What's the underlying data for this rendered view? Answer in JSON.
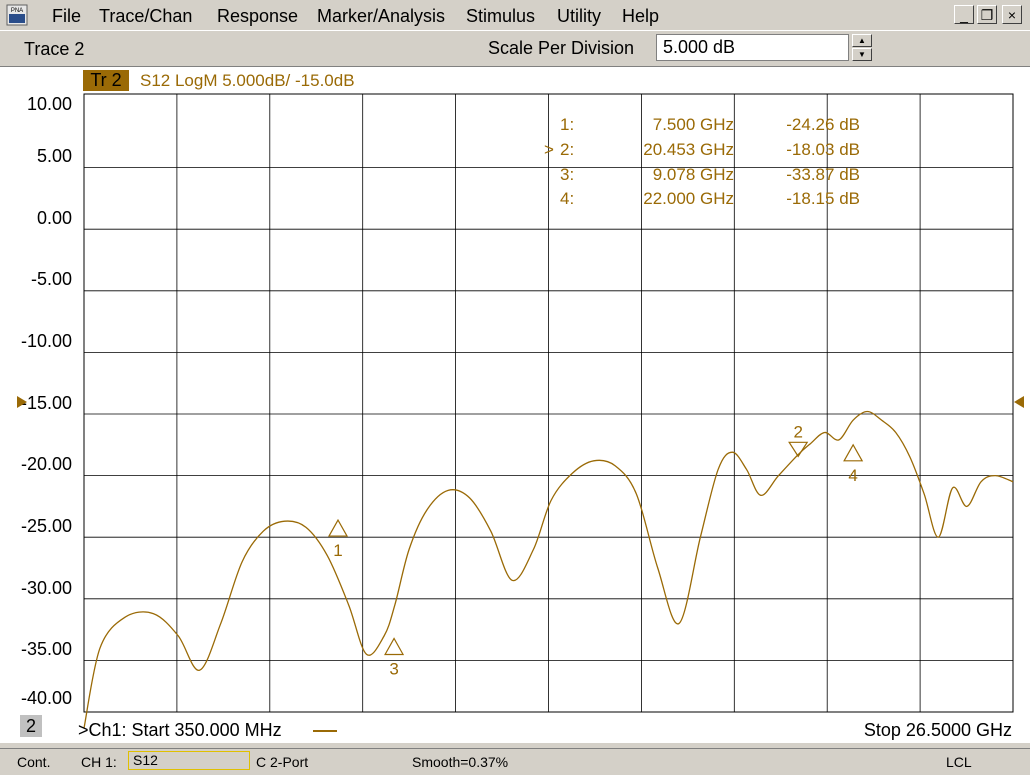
{
  "menu": {
    "items": [
      "File",
      "Trace/Chan",
      "Response",
      "Marker/Analysis",
      "Stimulus",
      "Utility",
      "Help"
    ],
    "app_icon_text": "PNA"
  },
  "window_controls": {
    "minimize": "_",
    "restore": "❐",
    "close": "×"
  },
  "toolbar": {
    "trace_label": "Trace 2",
    "scale_label": "Scale Per Division",
    "scale_value": "5.000 dB",
    "spin_up": "▲",
    "spin_down": "▼"
  },
  "trace": {
    "tag": "Tr 2",
    "info": "S12 LogM 5.000dB/  -15.0dB",
    "color": "#9a6a06"
  },
  "y_axis": {
    "labels": [
      "10.00",
      "5.00",
      "0.00",
      "-5.00",
      "-10.00",
      "-15.00",
      "-20.00",
      "-25.00",
      "-30.00",
      "-35.00",
      "-40.00"
    ]
  },
  "markers": {
    "rows": [
      {
        "id": "1:",
        "active": "",
        "freq": "7.500 GHz",
        "value": "-24.26 dB"
      },
      {
        "id": "2:",
        "active": ">",
        "freq": "20.453 GHz",
        "value": "-18.03 dB"
      },
      {
        "id": "3:",
        "active": "",
        "freq": "9.078 GHz",
        "value": "-33.87 dB"
      },
      {
        "id": "4:",
        "active": "",
        "freq": "22.000 GHz",
        "value": "-18.15 dB"
      }
    ],
    "labels": [
      "1",
      "2",
      "3",
      "4"
    ]
  },
  "channel": {
    "number": "2",
    "start": ">Ch1: Start  350.000 MHz",
    "stop": "Stop  26.5000 GHz"
  },
  "status": {
    "mode": "Cont.",
    "channel": "CH 1:",
    "measurement": "S12",
    "cal": "C  2-Port",
    "smooth": "Smooth=0.37%",
    "remote": "LCL"
  },
  "chart_data": {
    "type": "line",
    "x_unit": "GHz",
    "y_unit": "dB",
    "xlim": [
      0.35,
      26.5
    ],
    "ylim": [
      -40,
      10
    ],
    "reference_level": -15,
    "grid": true,
    "series": [
      {
        "x": [
          0.35,
          0.8,
          1.5,
          2.3,
          3.0,
          3.6,
          4.2,
          4.8,
          5.4,
          6.0,
          6.6,
          7.2,
          7.8,
          8.3,
          8.8,
          9.1,
          9.5,
          10.0,
          10.6,
          11.2,
          11.8,
          12.4,
          13.0,
          13.5,
          14.1,
          14.7,
          15.3,
          15.9,
          16.5,
          17.1,
          17.7,
          18.2,
          18.6,
          19.0,
          19.4,
          19.9,
          20.45,
          20.8,
          21.2,
          21.6,
          22.0,
          22.4,
          22.8,
          23.2,
          23.6,
          24.0,
          24.4,
          24.8,
          25.2,
          25.6,
          26.0,
          26.5
        ],
        "y": [
          -40.5,
          -34,
          -31.5,
          -31.2,
          -33,
          -35.8,
          -32,
          -27,
          -24.5,
          -23.7,
          -24.2,
          -26.5,
          -30.5,
          -34.5,
          -33,
          -30.5,
          -26,
          -22.8,
          -21.2,
          -21.8,
          -24.5,
          -28.5,
          -26,
          -22,
          -19.8,
          -18.8,
          -19.2,
          -21.5,
          -27.5,
          -32,
          -25,
          -19.5,
          -18.1,
          -19.5,
          -21.6,
          -20,
          -18.3,
          -17.4,
          -16.5,
          -17.1,
          -15.5,
          -14.8,
          -15.5,
          -16.5,
          -18.5,
          -21.5,
          -25,
          -21,
          -22.5,
          -20.5,
          -20,
          -20.5
        ]
      }
    ],
    "marker_points": [
      {
        "label": "1",
        "x": 7.5,
        "y": -24.26,
        "direction": "up"
      },
      {
        "label": "2",
        "x": 20.453,
        "y": -18.03,
        "direction": "down"
      },
      {
        "label": "3",
        "x": 9.078,
        "y": -33.87,
        "direction": "up"
      },
      {
        "label": "4",
        "x": 22.0,
        "y": -18.15,
        "direction": "up"
      }
    ]
  }
}
